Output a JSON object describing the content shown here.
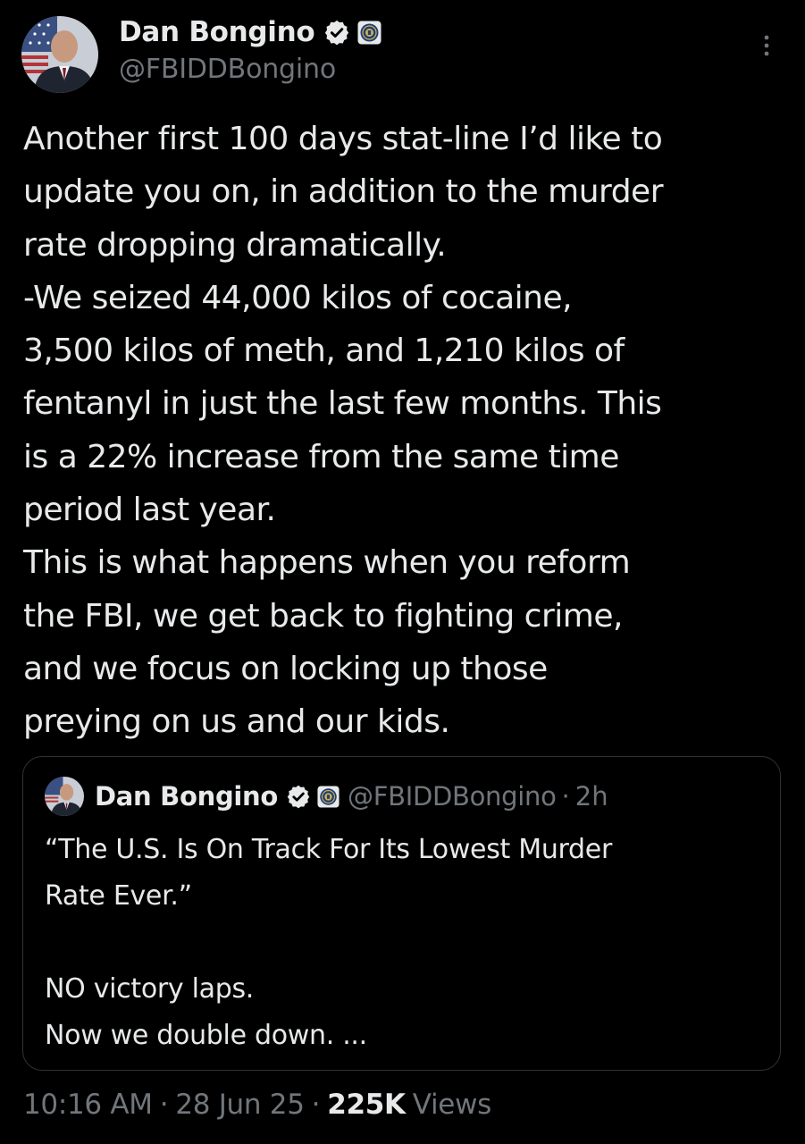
{
  "author": {
    "display_name": "Dan Bongino",
    "handle": "@FBIDDBongino",
    "avatar_icon": "profile-photo",
    "verified_icon": "verified-badge-icon",
    "affiliation_icon": "fbi-seal-icon"
  },
  "tweet": {
    "text": "Another first 100 days stat-line I’d like to\nupdate you on, in addition to the murder\nrate dropping dramatically.\n-We seized 44,000 kilos of cocaine,\n3,500 kilos of meth, and 1,210 kilos of\nfentanyl in just the last few months. This\nis a 22% increase from the same time\nperiod last year.\nThis is what happens when you reform\nthe FBI, we get back to fighting crime,\nand we focus on locking up those\npreying on us and our kids."
  },
  "quoted_tweet": {
    "display_name": "Dan Bongino",
    "handle": "@FBIDDBongino",
    "separator": "·",
    "time_ago": "2h",
    "text": "“The U.S. Is On Track For Its Lowest Murder\nRate Ever.”\n\nNO victory laps.\nNow we double down. ..."
  },
  "meta": {
    "time": "10:16 AM",
    "separator": "·",
    "date": "28 Jun 25",
    "views_count": "225K",
    "views_label": "Views"
  },
  "colors": {
    "background": "#000000",
    "primary_text": "#e7e9ea",
    "secondary_text": "#71767b",
    "verified_blue": "#1d9bf0",
    "border": "#2f3336"
  }
}
